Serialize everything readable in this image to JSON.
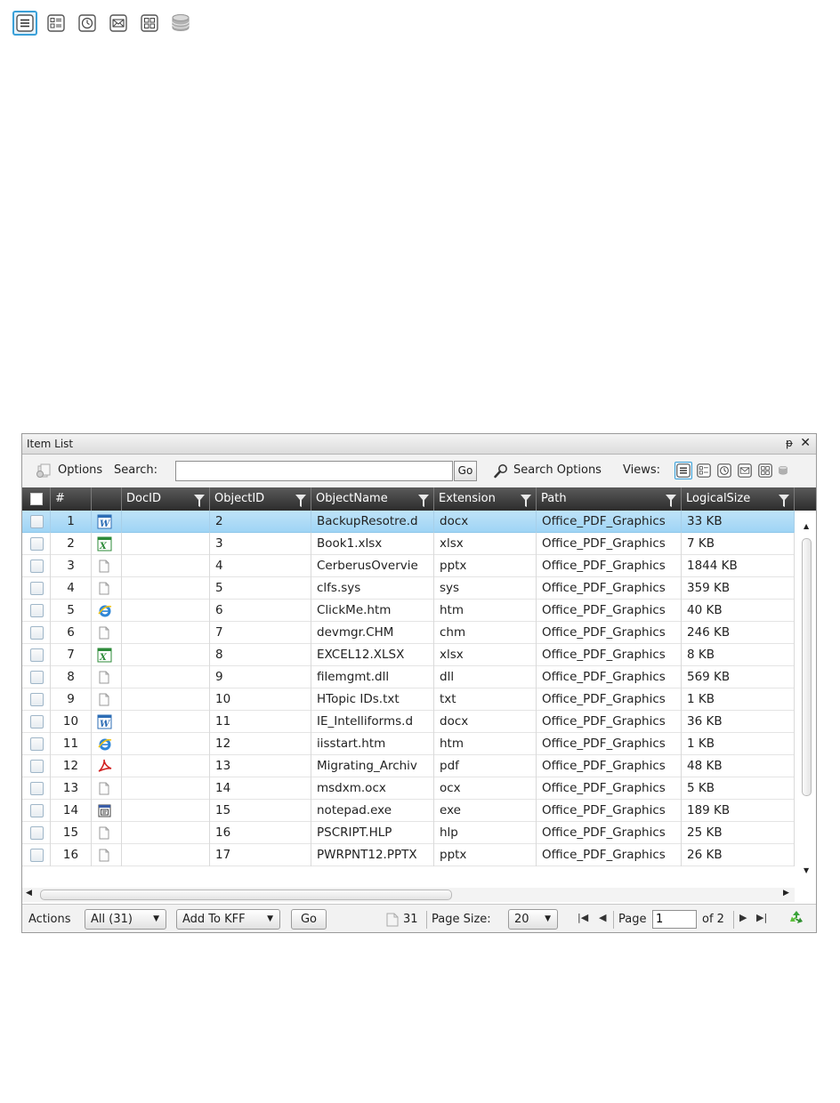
{
  "top_views": {
    "icons": [
      "list-view-icon",
      "details-view-icon",
      "timeline-view-icon",
      "email-view-icon",
      "thumbnail-view-icon",
      "database-view-icon"
    ],
    "active": "list-view-icon"
  },
  "panel": {
    "title": "Item List",
    "pin_glyph": "ᵽ",
    "close_glyph": "✕"
  },
  "toolbar": {
    "options_label": "Options",
    "search_label": "Search:",
    "search_value": "",
    "go_label": "Go",
    "search_options_label": "Search Options",
    "views_label": "Views:"
  },
  "columns": [
    {
      "key": "check",
      "label": ""
    },
    {
      "key": "num",
      "label": "#"
    },
    {
      "key": "icon",
      "label": ""
    },
    {
      "key": "docid",
      "label": "DocID"
    },
    {
      "key": "objectid",
      "label": "ObjectID"
    },
    {
      "key": "objectname",
      "label": "ObjectName"
    },
    {
      "key": "extension",
      "label": "Extension"
    },
    {
      "key": "path",
      "label": "Path"
    },
    {
      "key": "logicalsize",
      "label": "LogicalSize"
    }
  ],
  "rows": [
    {
      "num": "1",
      "icon": "word",
      "docid": "",
      "objectid": "2",
      "objectname": "BackupResotre.d",
      "extension": "docx",
      "path": "Office_PDF_Graphics",
      "logicalsize": "33 KB",
      "selected": true
    },
    {
      "num": "2",
      "icon": "excel",
      "docid": "",
      "objectid": "3",
      "objectname": "Book1.xlsx",
      "extension": "xlsx",
      "path": "Office_PDF_Graphics",
      "logicalsize": "7 KB"
    },
    {
      "num": "3",
      "icon": "generic",
      "docid": "",
      "objectid": "4",
      "objectname": "CerberusOvervie",
      "extension": "pptx",
      "path": "Office_PDF_Graphics",
      "logicalsize": "1844 KB"
    },
    {
      "num": "4",
      "icon": "generic",
      "docid": "",
      "objectid": "5",
      "objectname": "clfs.sys",
      "extension": "sys",
      "path": "Office_PDF_Graphics",
      "logicalsize": "359 KB"
    },
    {
      "num": "5",
      "icon": "ie",
      "docid": "",
      "objectid": "6",
      "objectname": "ClickMe.htm",
      "extension": "htm",
      "path": "Office_PDF_Graphics",
      "logicalsize": "40 KB"
    },
    {
      "num": "6",
      "icon": "generic",
      "docid": "",
      "objectid": "7",
      "objectname": "devmgr.CHM",
      "extension": "chm",
      "path": "Office_PDF_Graphics",
      "logicalsize": "246 KB"
    },
    {
      "num": "7",
      "icon": "excel",
      "docid": "",
      "objectid": "8",
      "objectname": "EXCEL12.XLSX",
      "extension": "xlsx",
      "path": "Office_PDF_Graphics",
      "logicalsize": "8 KB"
    },
    {
      "num": "8",
      "icon": "generic",
      "docid": "",
      "objectid": "9",
      "objectname": "filemgmt.dll",
      "extension": "dll",
      "path": "Office_PDF_Graphics",
      "logicalsize": "569 KB"
    },
    {
      "num": "9",
      "icon": "generic",
      "docid": "",
      "objectid": "10",
      "objectname": "HTopic IDs.txt",
      "extension": "txt",
      "path": "Office_PDF_Graphics",
      "logicalsize": "1 KB"
    },
    {
      "num": "10",
      "icon": "word",
      "docid": "",
      "objectid": "11",
      "objectname": "IE_Intelliforms.d",
      "extension": "docx",
      "path": "Office_PDF_Graphics",
      "logicalsize": "36 KB"
    },
    {
      "num": "11",
      "icon": "ie",
      "docid": "",
      "objectid": "12",
      "objectname": "iisstart.htm",
      "extension": "htm",
      "path": "Office_PDF_Graphics",
      "logicalsize": "1 KB"
    },
    {
      "num": "12",
      "icon": "pdf",
      "docid": "",
      "objectid": "13",
      "objectname": "Migrating_Archiv",
      "extension": "pdf",
      "path": "Office_PDF_Graphics",
      "logicalsize": "48 KB"
    },
    {
      "num": "13",
      "icon": "generic",
      "docid": "",
      "objectid": "14",
      "objectname": "msdxm.ocx",
      "extension": "ocx",
      "path": "Office_PDF_Graphics",
      "logicalsize": "5 KB"
    },
    {
      "num": "14",
      "icon": "exe",
      "docid": "",
      "objectid": "15",
      "objectname": "notepad.exe",
      "extension": "exe",
      "path": "Office_PDF_Graphics",
      "logicalsize": "189 KB"
    },
    {
      "num": "15",
      "icon": "generic",
      "docid": "",
      "objectid": "16",
      "objectname": "PSCRIPT.HLP",
      "extension": "hlp",
      "path": "Office_PDF_Graphics",
      "logicalsize": "25 KB"
    },
    {
      "num": "16",
      "icon": "generic",
      "docid": "",
      "objectid": "17",
      "objectname": "PWRPNT12.PPTX",
      "extension": "pptx",
      "path": "Office_PDF_Graphics",
      "logicalsize": "26 KB"
    }
  ],
  "footer": {
    "actions_label": "Actions",
    "scope_value": "All (31)",
    "action_value": "Add To KFF",
    "go_label": "Go",
    "item_count": "31",
    "page_size_label": "Page Size:",
    "page_size_value": "20",
    "page_label": "Page",
    "page_value": "1",
    "of_label": "of 2"
  },
  "colors": {
    "selected_row": "#a8d8f6",
    "header_bg": "#3a3a3a",
    "accent": "#3aa0d8"
  }
}
